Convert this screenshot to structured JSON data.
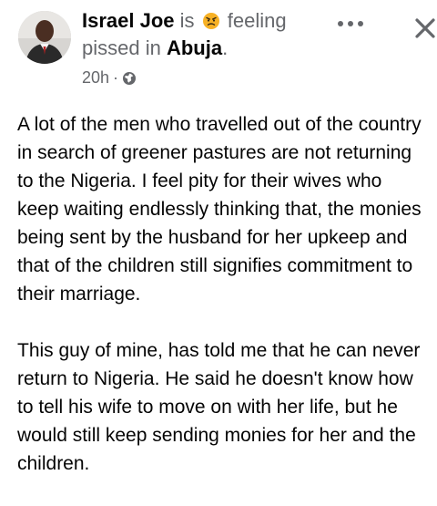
{
  "post": {
    "author": "Israel Joe",
    "status_prefix": "is",
    "feeling_text": "feeling pissed",
    "location_prefix": "in",
    "location": "Abuja",
    "location_suffix": ".",
    "timestamp": "20h",
    "separator": "·",
    "audience_icon": "globe-icon",
    "feeling_icon": "angry-face-emoji",
    "paragraphs": [
      "A lot of the men who travelled out of the country in search of greener pastures are not returning to the Nigeria. I feel pity for their wives who keep waiting endlessly thinking that, the monies being sent by the husband for her upkeep and that of the children still signifies commitment to their marriage.",
      "This guy of mine, has told me that he can never return to Nigeria. He said he doesn't know how to tell his wife to move on with her life, but he would still keep sending monies for her and the children."
    ]
  },
  "actions": {
    "more_icon": "more-horizontal-icon",
    "close_icon": "close-icon"
  },
  "colors": {
    "name": "#050505",
    "secondary": "#65676b",
    "body": "#050505",
    "emoji": "#f7b125"
  }
}
